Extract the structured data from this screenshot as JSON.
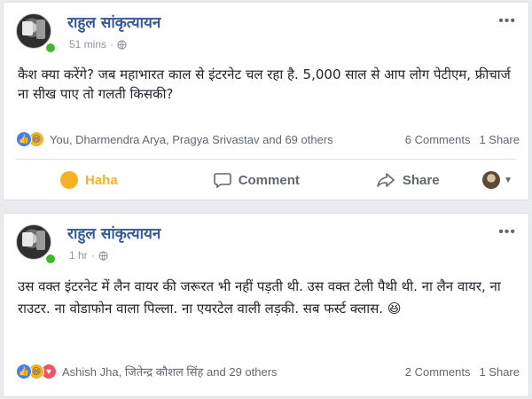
{
  "posts": [
    {
      "author": "राहुल सांकृत्यायन",
      "time": "51 mins",
      "text": "कैश क्या करेंगे? जब महाभारत काल से इंटरनेट चल रहा है. 5,000 साल से आप लोग पेटीएम, फ्रीचार्ज ना सीख पाए तो गलती किसकी?",
      "reaction_names": "You, Dharmendra Arya, Pragya Srivastav and 69 others",
      "comments": "6 Comments",
      "shares": "1 Share",
      "actions": {
        "haha": "Haha",
        "comment": "Comment",
        "share": "Share"
      }
    },
    {
      "author": "राहुल सांकृत्यायन",
      "time": "1 hr",
      "text": "उस वक्त इंटरनेट में लैन वायर की जरूरत भी नहीं पड़ती थी. उस वक्त टेली पैथी थी. ना लैन वायर, ना राउटर. ना वोडाफोन वाला पिल्ला. ना एयरटेल वाली लड़की. सब फर्स्ट क्लास. 😆",
      "reaction_names": "Ashish Jha, जितेन्द्र कौशल सिंह and 29 others",
      "comments": "2 Comments",
      "shares": "1 Share"
    }
  ],
  "colors": {
    "author_link": "#365899",
    "haha_yellow": "#f7b125",
    "like_blue": "#4080ff",
    "love_red": "#f25268",
    "online_green": "#42b72a"
  },
  "icons": {
    "more": "more-options-icon",
    "globe": "globe-icon",
    "like": "like-reaction-icon",
    "haha": "haha-reaction-icon",
    "love": "love-reaction-icon",
    "comment": "comment-icon",
    "share": "share-icon"
  }
}
